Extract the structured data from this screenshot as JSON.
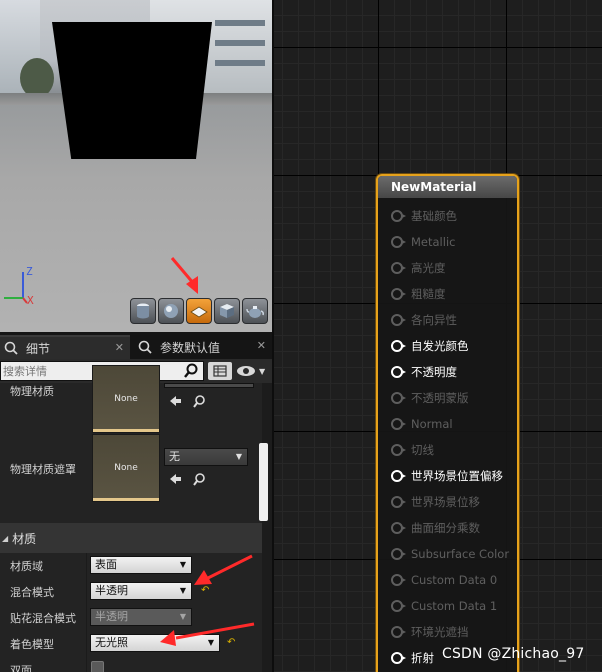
{
  "viewport": {
    "axes": {
      "z": "Z",
      "x": "X"
    },
    "toolbar_icons": [
      "cylinder-icon",
      "sphere-icon",
      "plane-icon",
      "cube-icon",
      "teapot-icon"
    ],
    "active_tool": "plane-icon"
  },
  "tabs": [
    {
      "label": "细节",
      "close": "✕"
    },
    {
      "label": "参数默认值",
      "close": "✕"
    }
  ],
  "search": {
    "placeholder": "搜索详情"
  },
  "physical": {
    "phys_material_label": "物理材质",
    "phys_material_thumb": "None",
    "phys_mask_label": "物理材质遮罩",
    "phys_mask_thumb": "None",
    "phys_mask_combo": "无"
  },
  "material_section": {
    "title": "材质",
    "rows": [
      {
        "label": "材质域",
        "value": "表面"
      },
      {
        "label": "混合模式",
        "value": "半透明"
      },
      {
        "label": "贴花混合模式",
        "value": "半透明"
      },
      {
        "label": "着色模型",
        "value": "无光照"
      },
      {
        "label": "双面",
        "value": ""
      }
    ]
  },
  "node": {
    "title": "NewMaterial",
    "pins": [
      {
        "label": "基础颜色",
        "active": false
      },
      {
        "label": "Metallic",
        "active": false
      },
      {
        "label": "高光度",
        "active": false
      },
      {
        "label": "粗糙度",
        "active": false
      },
      {
        "label": "各向异性",
        "active": false
      },
      {
        "label": "自发光颜色",
        "active": true
      },
      {
        "label": "不透明度",
        "active": true
      },
      {
        "label": "不透明蒙版",
        "active": false
      },
      {
        "label": "Normal",
        "active": false
      },
      {
        "label": "切线",
        "active": false
      },
      {
        "label": "世界场景位置偏移",
        "active": true
      },
      {
        "label": "世界场景位移",
        "active": false
      },
      {
        "label": "曲面细分乘数",
        "active": false
      },
      {
        "label": "Subsurface Color",
        "active": false
      },
      {
        "label": "Custom Data 0",
        "active": false
      },
      {
        "label": "Custom Data 1",
        "active": false
      },
      {
        "label": "环境光遮挡",
        "active": false
      },
      {
        "label": "折射",
        "active": true
      }
    ]
  },
  "watermark": "CSDN @Zhichao_97",
  "colors": {
    "accent": "#e6a21b",
    "annotation": "#ff2a2a",
    "reset_arrow": "#d9b100"
  }
}
